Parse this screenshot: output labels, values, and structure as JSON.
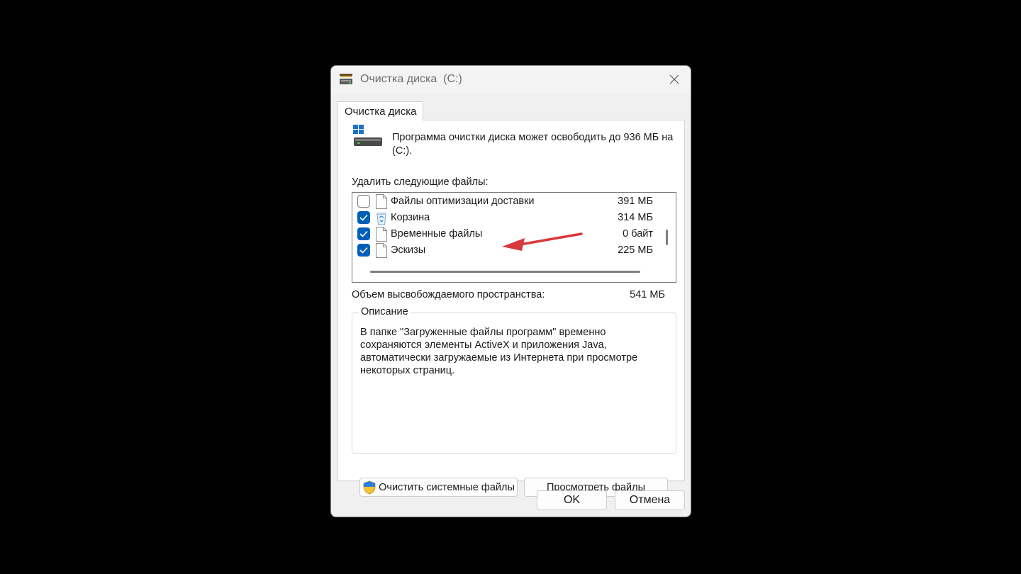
{
  "window": {
    "title": "Очистка диска  (C:)",
    "close_icon": "close-icon",
    "app_icon": "disk-cleanup-icon"
  },
  "tab": {
    "label": "Очистка диска"
  },
  "intro": {
    "text": "Программа очистки диска может освободить до 936 МБ на  (C:).",
    "icon": "drive-icon"
  },
  "files": {
    "label": "Удалить следующие файлы:",
    "items": [
      {
        "name": "Файлы оптимизации доставки",
        "size": "391 МБ",
        "checked": false,
        "icon": "file-icon"
      },
      {
        "name": "Корзина",
        "size": "314 МБ",
        "checked": true,
        "icon": "recycle-bin-icon"
      },
      {
        "name": "Временные файлы",
        "size": "0 байт",
        "checked": true,
        "icon": "file-icon"
      },
      {
        "name": "Эскизы",
        "size": "225 МБ",
        "checked": true,
        "icon": "file-icon"
      }
    ]
  },
  "free_space": {
    "label": "Объем высвобождаемого пространства:",
    "value": "541 МБ"
  },
  "description": {
    "title": "Описание",
    "text": "В папке \"Загруженные файлы программ\" временно сохраняются элементы ActiveX и приложения Java, автоматически загружаемые из Интернета при просмотре некоторых страниц."
  },
  "buttons": {
    "clean_system": "Очистить системные файлы",
    "view_files": "Просмотреть файлы",
    "ok": "OK",
    "cancel": "Отмена"
  },
  "colors": {
    "accent": "#005fb8",
    "annotation_arrow": "#d9383b"
  }
}
